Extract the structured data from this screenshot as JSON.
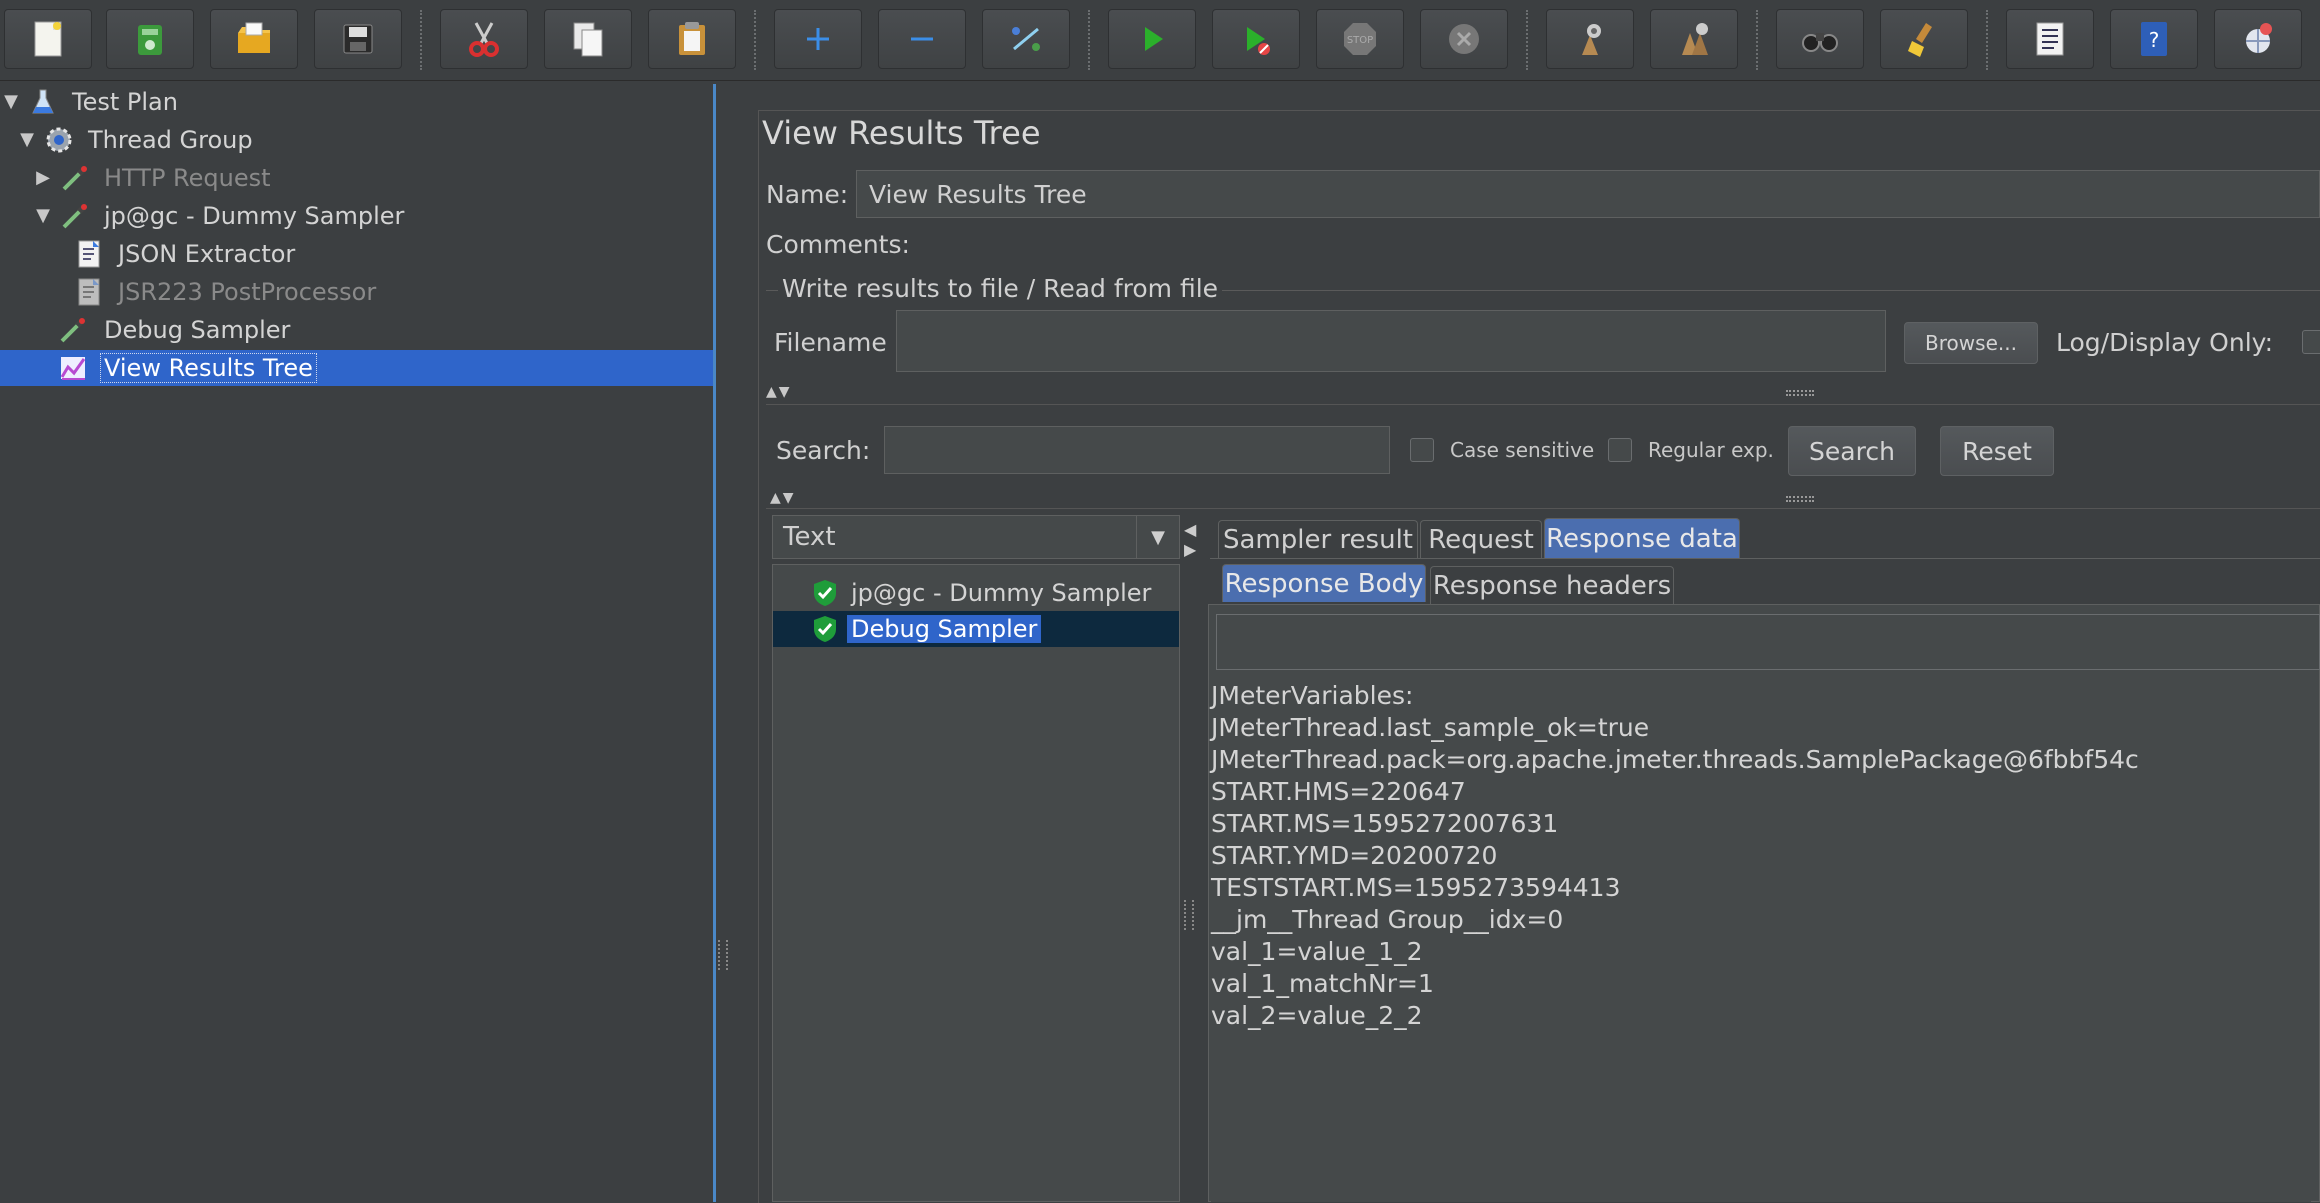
{
  "toolbar": {
    "buttons": [
      {
        "name": "new-icon"
      },
      {
        "name": "templates-icon"
      },
      {
        "name": "open-icon"
      },
      {
        "name": "save-icon"
      },
      {
        "name": "cut-icon"
      },
      {
        "name": "copy-icon"
      },
      {
        "name": "paste-icon"
      },
      {
        "name": "expand-icon"
      },
      {
        "name": "collapse-icon"
      },
      {
        "name": "toggle-icon"
      },
      {
        "name": "start-icon"
      },
      {
        "name": "start-no-timers-icon"
      },
      {
        "name": "stop-icon"
      },
      {
        "name": "shutdown-icon"
      },
      {
        "name": "clear-icon"
      },
      {
        "name": "clear-all-icon"
      },
      {
        "name": "search-icon"
      },
      {
        "name": "reset-search-icon"
      },
      {
        "name": "function-helper-icon"
      },
      {
        "name": "help-icon"
      },
      {
        "name": "remote-icon"
      }
    ],
    "stop_text": "STOP"
  },
  "tree": {
    "items": [
      {
        "label": "Test Plan",
        "icon": "flask-icon",
        "expanded": true,
        "disabled": false
      },
      {
        "label": "Thread Group",
        "icon": "gear-icon",
        "expanded": true,
        "disabled": false
      },
      {
        "label": "HTTP Request",
        "icon": "pipette-icon",
        "expanded": false,
        "disabled": true
      },
      {
        "label": "jp@gc - Dummy Sampler",
        "icon": "pipette-icon",
        "expanded": true,
        "disabled": false
      },
      {
        "label": "JSON Extractor",
        "icon": "document-icon",
        "disabled": false
      },
      {
        "label": "JSR223 PostProcessor",
        "icon": "document-icon",
        "disabled": true
      },
      {
        "label": "Debug Sampler",
        "icon": "pipette-icon",
        "disabled": false
      },
      {
        "label": "View Results Tree",
        "icon": "chart-icon",
        "disabled": false,
        "selected": true
      }
    ]
  },
  "panel": {
    "title": "View Results Tree",
    "name_label": "Name:",
    "name_value": "View Results Tree",
    "comments_label": "Comments:",
    "file_section_title": "Write results to file / Read from file",
    "filename_label": "Filename",
    "filename_value": "",
    "browse_label": "Browse...",
    "log_display_label": "Log/Display Only:",
    "search_label": "Search:",
    "search_value": "",
    "case_sensitive_label": "Case sensitive",
    "regular_exp_label": "Regular exp.",
    "search_button": "Search",
    "reset_button": "Reset",
    "renderer_value": "Text"
  },
  "results": {
    "items": [
      {
        "label": "jp@gc - Dummy Sampler",
        "status": "success",
        "selected": false
      },
      {
        "label": "Debug Sampler",
        "status": "success",
        "selected": true
      }
    ]
  },
  "tabs": {
    "main": [
      "Sampler result",
      "Request",
      "Response data"
    ],
    "main_active": "Response data",
    "sub": [
      "Response Body",
      "Response headers"
    ],
    "sub_active": "Response Body"
  },
  "response_body": {
    "lines": [
      "JMeterVariables:",
      "JMeterThread.last_sample_ok=true",
      "JMeterThread.pack=org.apache.jmeter.threads.SamplePackage@6fbbf54c",
      "START.HMS=220647",
      "START.MS=1595272007631",
      "START.YMD=20200720",
      "TESTSTART.MS=1595273594413",
      "__jm__Thread Group__idx=0",
      "val_1=value_1_2",
      "val_1_matchNr=1",
      "val_2=value_2_2"
    ]
  }
}
